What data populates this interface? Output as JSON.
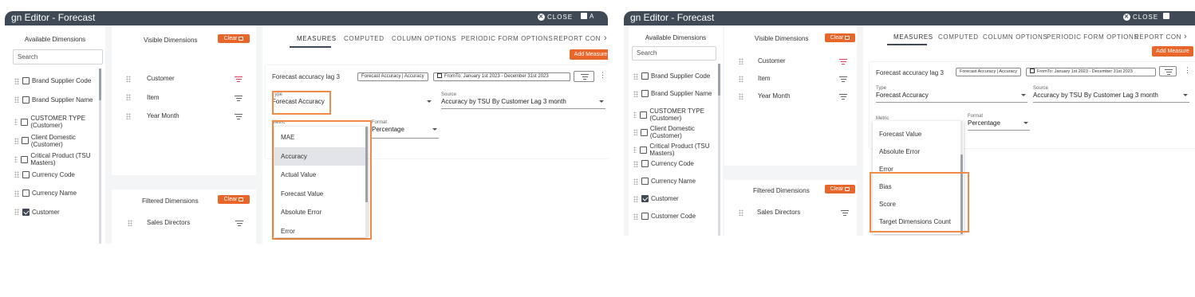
{
  "left": {
    "window_title": "gn Editor - Forecast",
    "close_label": "CLOSE",
    "save_label": "A",
    "available": {
      "header": "Available Dimensions",
      "search_placeholder": "Search",
      "items": [
        {
          "label": "Brand Supplier Code",
          "checked": false
        },
        {
          "label": "Brand Supplier Name",
          "checked": false
        },
        {
          "label": "CUSTOMER TYPE (Customer)",
          "checked": false
        },
        {
          "label": "Client Domestic (Customer)",
          "checked": false
        },
        {
          "label": "Critical Product (TSU Masters)",
          "checked": false
        },
        {
          "label": "Currency Code",
          "checked": false
        },
        {
          "label": "Currency Name",
          "checked": false
        },
        {
          "label": "Customer",
          "checked": true
        }
      ]
    },
    "visible": {
      "header": "Visible Dimensions",
      "clear_label": "Clear",
      "items": [
        {
          "label": "Customer",
          "filter_active": true
        },
        {
          "label": "Item",
          "filter_active": false
        },
        {
          "label": "Year Month",
          "filter_active": false
        }
      ]
    },
    "filtered": {
      "header": "Filtered Dimensions",
      "clear_label": "Clear",
      "items": [
        {
          "label": "Sales Directors"
        }
      ]
    },
    "tabs": [
      "MEASURES",
      "COMPUTED",
      "COLUMN OPTIONS",
      "PERIODIC FORM OPTIONS",
      "REPORT CON"
    ],
    "tabs_more": "›",
    "add_measure_label": "Add Measure",
    "measure": {
      "name": "Forecast accuracy lag 3",
      "chip_type": "Forecast Accuracy | Accuracy",
      "chip_date": "FromTo: January 1st 2023 - December 31st 2023",
      "type_label": "Type",
      "type_value": "Forecast Accuracy",
      "source_label": "Source",
      "source_value": "Accuracy by TSU By Customer Lag 3 month",
      "metric_label": "Metric",
      "format_label": "Format",
      "format_value": "Percentage"
    },
    "dropdown_items": [
      {
        "label": "MAE",
        "selected": false
      },
      {
        "label": "Accuracy",
        "selected": true
      },
      {
        "label": "Actual Value",
        "selected": false
      },
      {
        "label": "Forecast Value",
        "selected": false
      },
      {
        "label": "Absolute Error",
        "selected": false
      },
      {
        "label": "Error",
        "selected": false
      }
    ]
  },
  "right": {
    "window_title": "gn Editor - Forecast",
    "close_label": "CLOSE",
    "available": {
      "header": "Available Dimensions",
      "search_placeholder": "Search",
      "items": [
        {
          "label": "Brand Supplier Code",
          "checked": false
        },
        {
          "label": "Brand Supplier Name",
          "checked": false
        },
        {
          "label": "CUSTOMER TYPE (Customer)",
          "checked": false
        },
        {
          "label": "Client Domestic (Customer)",
          "checked": false
        },
        {
          "label": "Critical Product (TSU Masters)",
          "checked": false
        },
        {
          "label": "Currency Code",
          "checked": false
        },
        {
          "label": "Currency Name",
          "checked": false
        },
        {
          "label": "Customer",
          "checked": true
        },
        {
          "label": "Customer Code",
          "checked": false
        }
      ]
    },
    "visible": {
      "header": "Visible Dimensions",
      "clear_label": "Clear",
      "items": [
        {
          "label": "Customer",
          "filter_active": true
        },
        {
          "label": "Item",
          "filter_active": false
        },
        {
          "label": "Year Month",
          "filter_active": false
        }
      ]
    },
    "filtered": {
      "header": "Filtered Dimensions",
      "clear_label": "Clear",
      "items": [
        {
          "label": "Sales Directors"
        }
      ]
    },
    "tabs": [
      "MEASURES",
      "COMPUTED",
      "COLUMN OPTIONS",
      "PERIODIC FORM OPTIONS",
      "REPORT CON"
    ],
    "tabs_more": "›",
    "add_measure_label": "Add Measure",
    "measure": {
      "name": "Forecast accuracy lag 3",
      "chip_type": "Forecast Accuracy | Accuracy",
      "chip_date": "FromTo: January 1st 2023 - December 31st 2023",
      "type_label": "Type",
      "type_value": "Forecast Accuracy",
      "source_label": "Source",
      "source_value": "Accuracy by TSU By Customer Lag 3 month",
      "metric_label": "Metric",
      "format_label": "Format",
      "format_value": "Percentage"
    },
    "dropdown_items": [
      {
        "label": "Forecast Value"
      },
      {
        "label": "Absolute Error"
      },
      {
        "label": "Error"
      },
      {
        "label": "Bias"
      },
      {
        "label": "Score"
      },
      {
        "label": "Target Dimensions Count"
      }
    ]
  },
  "colors": {
    "accent": "#e8662a",
    "titlebar": "#3f4a56",
    "highlight": "#f08a45",
    "filter_active": "#e0445c"
  }
}
